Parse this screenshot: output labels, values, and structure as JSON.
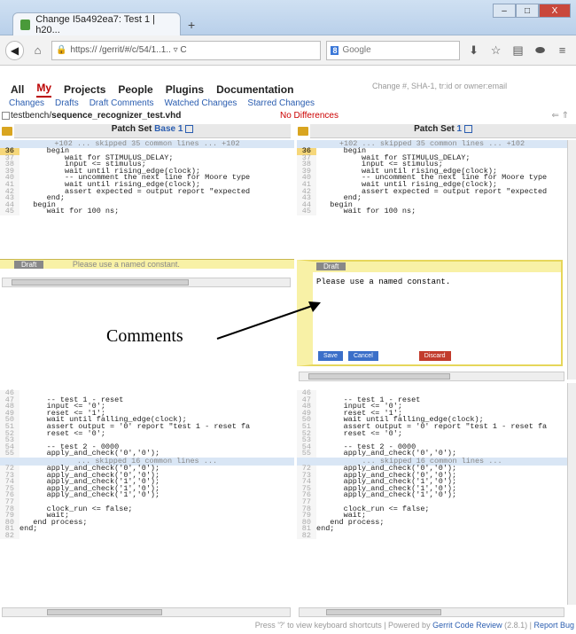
{
  "browser": {
    "tab_title": "Change I5a492ea7: Test 1 | h20...",
    "new_tab": "+",
    "url": "https://                           /gerrit/#/c/54/1..1..  ▿ C",
    "search_engine": "8",
    "search_placeholder": "Google",
    "win_minimize": "–",
    "win_maximize": "□",
    "win_close": "X"
  },
  "menu": {
    "items": [
      "All",
      "My",
      "Projects",
      "People",
      "Plugins",
      "Documentation"
    ],
    "active": "My",
    "search_placeholder": "Change #, SHA-1, tr:id or owner:email"
  },
  "submenu": [
    "Changes",
    "Drafts",
    "Draft Comments",
    "Watched Changes",
    "Starred Changes"
  ],
  "file": {
    "name_prefix": "testbench/",
    "name_bold": "sequence_recognizer_test.vhd",
    "status": "No Differences",
    "hint": "⇐ ⇑"
  },
  "left_header": {
    "label": "Patch Set",
    "link": "Base",
    "num": "1"
  },
  "right_header": {
    "label": "Patch Set",
    "link": "",
    "num": "1"
  },
  "skip_top_left": "+102 ... skipped 35 common lines ... +102",
  "skip_top_right": "+102 ... skipped 35 common lines ... +102",
  "top_lines": [
    {
      "n": "36",
      "t": "      begin",
      "hl": true
    },
    {
      "n": "37",
      "t": "          wait for STIMULUS_DELAY;"
    },
    {
      "n": "38",
      "t": "          input <= stimulus;"
    },
    {
      "n": "39",
      "t": "          wait until rising_edge(clock);"
    },
    {
      "n": "40",
      "t": "          -- uncomment the next line for Moore type"
    },
    {
      "n": "41",
      "t": "          wait until rising_edge(clock);"
    },
    {
      "n": "42",
      "t": "          assert expected = output report \"expected"
    },
    {
      "n": "43",
      "t": "      end;"
    },
    {
      "n": "44",
      "t": "   begin"
    },
    {
      "n": "45",
      "t": "      wait for 100 ns;"
    }
  ],
  "comment": {
    "draft_label": "Draft",
    "text": "Please use a named constant.",
    "save": "Save",
    "cancel": "Cancel",
    "discard": "Discard"
  },
  "annotation": "Comments",
  "bottom_lines": [
    {
      "n": "46",
      "t": ""
    },
    {
      "n": "47",
      "t": "      -- test 1 - reset"
    },
    {
      "n": "48",
      "t": "      input <= '0';"
    },
    {
      "n": "49",
      "t": "      reset <= '1';"
    },
    {
      "n": "50",
      "t": "      wait until falling_edge(clock);"
    },
    {
      "n": "51",
      "t": "      assert output = '0' report \"test 1 - reset fa"
    },
    {
      "n": "52",
      "t": "      reset <= '0';"
    },
    {
      "n": "53",
      "t": ""
    },
    {
      "n": "54",
      "t": "      -- test 2 - 0000"
    },
    {
      "n": "55",
      "t": "      apply_and_check('0','0');"
    }
  ],
  "skip_mid": "... skipped 16 common lines ...",
  "end_lines": [
    {
      "n": "72",
      "t": "      apply_and_check('0','0');"
    },
    {
      "n": "73",
      "t": "      apply_and_check('0','0');"
    },
    {
      "n": "74",
      "t": "      apply_and_check('1','0');"
    },
    {
      "n": "75",
      "t": "      apply_and_check('1','0');"
    },
    {
      "n": "76",
      "t": "      apply_and_check('1','0');"
    },
    {
      "n": "77",
      "t": ""
    },
    {
      "n": "78",
      "t": "      clock_run <= false;"
    },
    {
      "n": "79",
      "t": "      wait;"
    },
    {
      "n": "80",
      "t": "   end process;"
    },
    {
      "n": "81",
      "t": "end;"
    },
    {
      "n": "82",
      "t": ""
    }
  ],
  "footer": {
    "text": "Press '?' to view keyboard shortcuts | Powered by ",
    "link1": "Gerrit Code Review",
    "version": " (2.8.1) | ",
    "link2": "Report Bug"
  }
}
